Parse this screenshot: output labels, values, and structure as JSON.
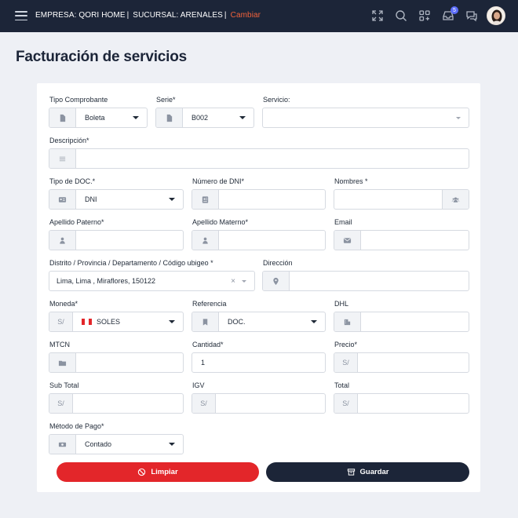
{
  "topbar": {
    "empresa": "EMPRESA: QORI HOME",
    "sucursal": "SUCURSAL: ARENALES",
    "cambiar": "Cambiar",
    "notifications_count": "5",
    "icons": [
      "fullscreen-icon",
      "search-icon",
      "apps-icon",
      "inbox-icon",
      "chat-icon"
    ]
  },
  "page": {
    "title": "Facturación de servicios"
  },
  "form": {
    "tipo_comprobante": {
      "label": "Tipo Comprobante",
      "value": "Boleta"
    },
    "serie": {
      "label": "Serie*",
      "value": "B002"
    },
    "servicio": {
      "label": "Servicio:",
      "value": ""
    },
    "descripcion": {
      "label": "Descripción*",
      "value": ""
    },
    "tipo_doc": {
      "label": "Tipo de DOC.*",
      "value": "DNI"
    },
    "numero_dni": {
      "label": "Número de DNI*",
      "value": ""
    },
    "nombres": {
      "label": "Nombres *",
      "value": ""
    },
    "apellido_paterno": {
      "label": "Apellido Paterno*",
      "value": ""
    },
    "apellido_materno": {
      "label": "Apellido Materno*",
      "value": ""
    },
    "email": {
      "label": "Email",
      "value": ""
    },
    "ubigeo": {
      "label": "Distrito / Provincia / Departamento / Código ubigeo *",
      "value": "Lima, Lima , Miraflores, 150122",
      "clear": "×"
    },
    "direccion": {
      "label": "Dirección",
      "value": ""
    },
    "moneda": {
      "label": "Moneda*",
      "prefix": "S/",
      "value": "SOLES"
    },
    "referencia": {
      "label": "Referencia",
      "value": "DOC."
    },
    "dhl": {
      "label": "DHL",
      "value": ""
    },
    "mtcn": {
      "label": "MTCN",
      "value": ""
    },
    "cantidad": {
      "label": "Cantidad*",
      "value": "1"
    },
    "precio": {
      "label": "Precio*",
      "prefix": "S/",
      "value": ""
    },
    "sub_total": {
      "label": "Sub Total",
      "prefix": "S/",
      "value": ""
    },
    "igv": {
      "label": "IGV",
      "prefix": "S/",
      "value": ""
    },
    "total": {
      "label": "Total",
      "prefix": "S/",
      "value": ""
    },
    "metodo_pago": {
      "label": "Método de Pago*",
      "value": "Contado"
    }
  },
  "actions": {
    "clear_label": "Limpiar",
    "save_label": "Guardar"
  },
  "colors": {
    "topbar": "#1c2538",
    "accent": "#f2623b",
    "danger": "#e3262a",
    "primary": "#1c2538"
  }
}
